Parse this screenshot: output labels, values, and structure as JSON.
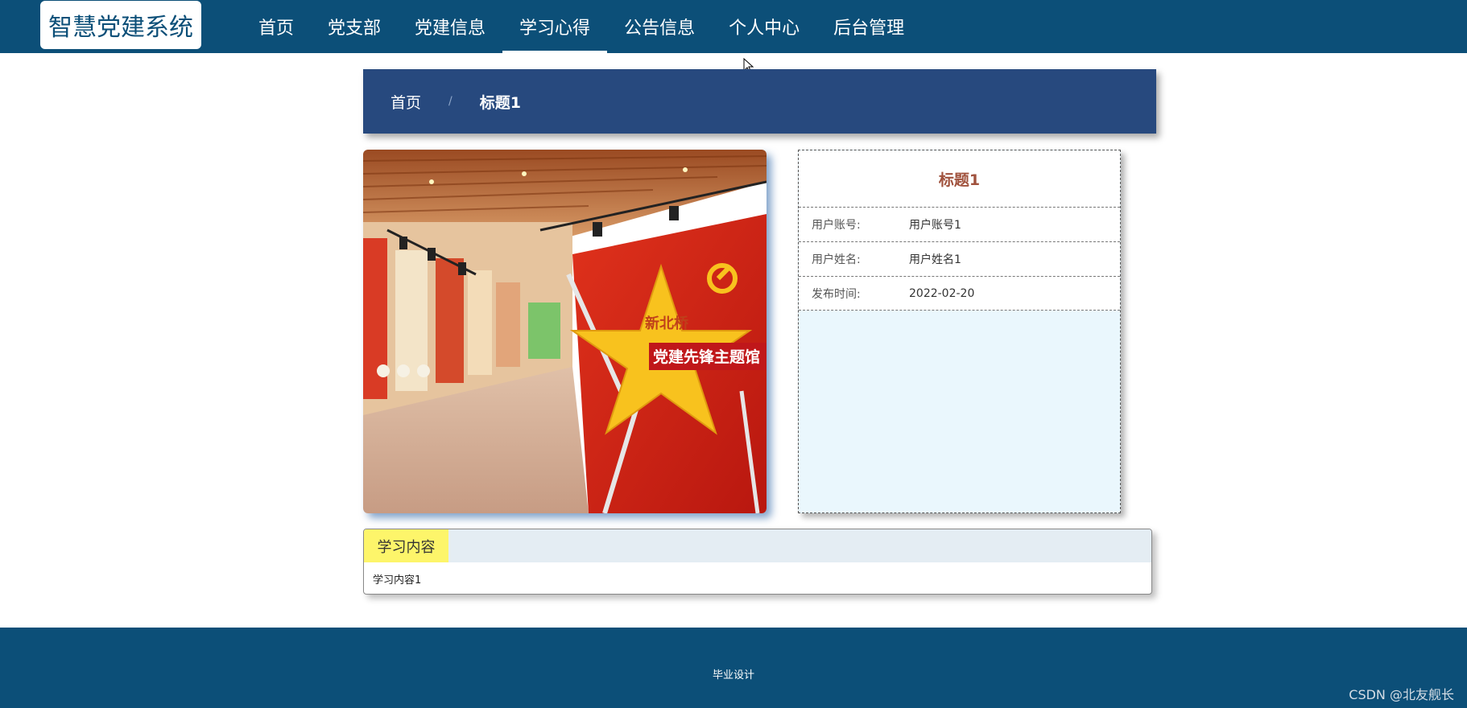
{
  "brand": {
    "logo_text": "智慧党建系统"
  },
  "nav": {
    "items": [
      {
        "label": "首页"
      },
      {
        "label": "党支部"
      },
      {
        "label": "党建信息"
      },
      {
        "label": "学习心得"
      },
      {
        "label": "公告信息"
      },
      {
        "label": "个人中心"
      },
      {
        "label": "后台管理"
      }
    ],
    "active": "学习心得"
  },
  "breadcrumb": {
    "home": "首页",
    "separator": "/",
    "current": "标题1"
  },
  "image": {
    "sign_text_top": "新北桥",
    "sign_text_main": "党建先锋主题馆"
  },
  "details": {
    "title": "标题1",
    "rows": [
      {
        "label": "用户账号:",
        "value": "用户账号1"
      },
      {
        "label": "用户姓名:",
        "value": "用户姓名1"
      },
      {
        "label": "发布时间:",
        "value": "2022-02-20"
      }
    ]
  },
  "content": {
    "tab_label": "学习内容",
    "body": "学习内容1"
  },
  "footer": {
    "text": "毕业设计"
  },
  "watermark": "CSDN @北友舰长",
  "colors": {
    "navbar": "#0c4f78",
    "breadcrumb": "#27497e",
    "details_title": "#a0523d",
    "tab_highlight": "#fdf56a"
  }
}
